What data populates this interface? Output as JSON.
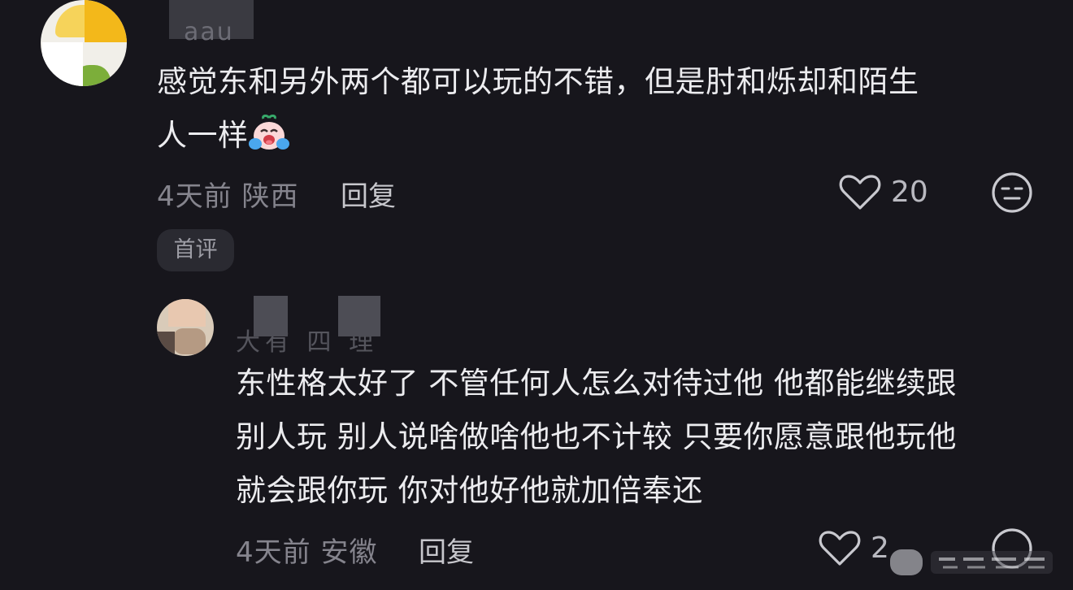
{
  "comment": {
    "username": "aau",
    "text_line1": "感觉东和另外两个都可以玩的不错，但是肘和烁却和陌生",
    "text_line2": "人一样",
    "emoji": "crying-face-emoji",
    "time": "4天前",
    "location": "陕西",
    "reply_label": "回复",
    "like_count": "20",
    "first_badge": "首评",
    "icons": [
      "heart-icon",
      "neutral-face-icon"
    ]
  },
  "reply": {
    "username": "大有 四 理",
    "text_line1": "东性格太好了 不管任何人怎么对待过他 他都能继续跟",
    "text_line2": "别人玩 别人说啥做啥他也不计较 只要你愿意跟他玩他",
    "text_line3": "就会跟你玩 你对他好他就加倍奉还",
    "time": "4天前",
    "location": "安徽",
    "reply_label": "回复",
    "like_count": "2",
    "icons": [
      "heart-icon",
      "neutral-face-icon"
    ]
  },
  "colors": {
    "background": "#17161c",
    "primary_text": "#ececef",
    "meta_text": "#85848d",
    "badge_bg": "#2a2a31"
  }
}
